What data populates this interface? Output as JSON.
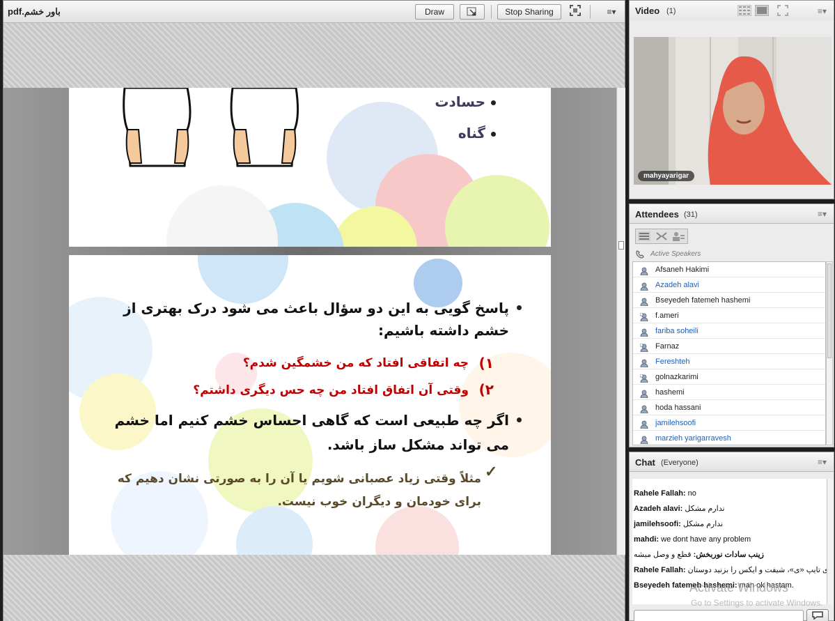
{
  "share": {
    "filename": "باور خشم.pdf",
    "draw_label": "Draw",
    "stop_sharing_label": "Stop Sharing",
    "menu_icon": "≡▾"
  },
  "slide1": {
    "bullets": [
      "حسادت",
      "گناه"
    ]
  },
  "slide2": {
    "bullet1": "پاسخ گویی به این دو سؤال باعث می شود درک بهتری از خشم داشته باشیم:",
    "q1_num": "۱)",
    "q1": "چه اتفاقی افتاد که من خشمگین شدم؟",
    "q2_num": "۲)",
    "q2": "وقتی آن اتفاق افتاد من چه حس دیگری داشتم؟",
    "bullet2": "اگر چه طبیعی است که گاهی احساس خشم کنیم اما خشم می تواند مشکل ساز باشد.",
    "check_mark": "✓",
    "example": "مثلاً وقتی زیاد عصبانی شویم یا آن را به صورتی نشان دهیم که برای خودمان و دیگران خوب نیست."
  },
  "video": {
    "title": "Video",
    "count": "(1)",
    "presenter": "mahyayarigar"
  },
  "attendees": {
    "title": "Attendees",
    "count": "(31)",
    "active_speakers": "Active Speakers",
    "list": [
      {
        "name": "Afsaneh Hakimi",
        "blue": false
      },
      {
        "name": "Azadeh alavi",
        "blue": true
      },
      {
        "name": "Bseyedeh fatemeh hashemi",
        "blue": false
      },
      {
        "name": "f.ameri",
        "blue": false
      },
      {
        "name": "fariba soheili",
        "blue": true
      },
      {
        "name": "Farnaz",
        "blue": false
      },
      {
        "name": "Fereshteh",
        "blue": true
      },
      {
        "name": "golnazkarimi",
        "blue": false
      },
      {
        "name": "hashemi",
        "blue": false
      },
      {
        "name": "hoda hassani",
        "blue": false
      },
      {
        "name": "jamilehsoofi",
        "blue": true
      },
      {
        "name": "marzieh yarigarravesh",
        "blue": true
      }
    ]
  },
  "chat": {
    "title": "Chat",
    "scope": "(Everyone)",
    "messages": [
      {
        "sender": "Rahele Fallah:",
        "text": " no"
      },
      {
        "sender": "Azadeh alavi:",
        "text": " ندارم مشکل"
      },
      {
        "sender": "jamilehsoofi:",
        "text": " ندارم مشکل"
      },
      {
        "sender": "mahdi:",
        "text": " we dont have any problem"
      },
      {
        "sender": "زینب سادات نوربخش:",
        "text": " قطع و وصل میشه"
      },
      {
        "sender": "Rahele Fallah:",
        "text": " برای تایپ «ی»، شیفت و ایکس را بزنید دوستان"
      },
      {
        "sender": "Bseyedeh fatemeh hashemi:",
        "text": " man ok hastam."
      }
    ],
    "send_icon": "speech-bubble-icon"
  },
  "watermark": {
    "line1": "Activate Windows",
    "line2": "Go to Settings to activate Windows."
  }
}
